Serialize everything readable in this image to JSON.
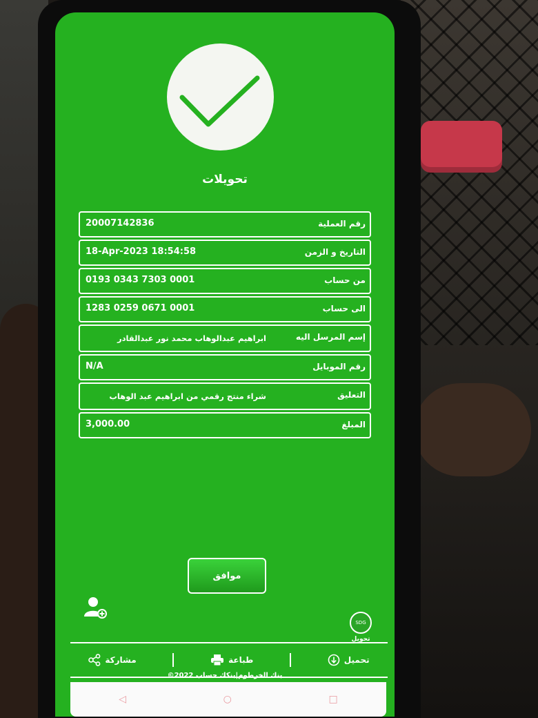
{
  "screen_title": "تحويلات",
  "details": [
    {
      "label": "رقم العملية",
      "value": "20007142836"
    },
    {
      "label": "التاريخ و الزمن",
      "value": "18-Apr-2023 18:54:58"
    },
    {
      "label": "من حساب",
      "value": "0193 0343 7303 0001"
    },
    {
      "label": "الى حساب",
      "value": "1283 0259 0671 0001"
    },
    {
      "label": "إسم المرسل اليه",
      "value": "ابراهيم عبدالوهاب محمد نور عبدالقادر"
    },
    {
      "label": "رقم الموبايل",
      "value": "N/A"
    },
    {
      "label": "التعليق",
      "value": "شراء منتج رقمي من ابراهيم عبد الوهاب"
    },
    {
      "label": "المبلغ",
      "value": "3,000.00"
    }
  ],
  "ok_button": "موافق",
  "transfer_label": "تحويل",
  "transfer_icon_text": "SDG",
  "actions": {
    "share": "مشاركة",
    "print": "طباعة",
    "download": "تحميل"
  },
  "footer": "©2022 بنك الخرطوم|بنكك حساب",
  "colors": {
    "screen": "#25b120",
    "check": "#25b120"
  },
  "icons": [
    "checkmark-icon",
    "add-user-icon",
    "share-icon",
    "print-icon",
    "download-icon"
  ]
}
